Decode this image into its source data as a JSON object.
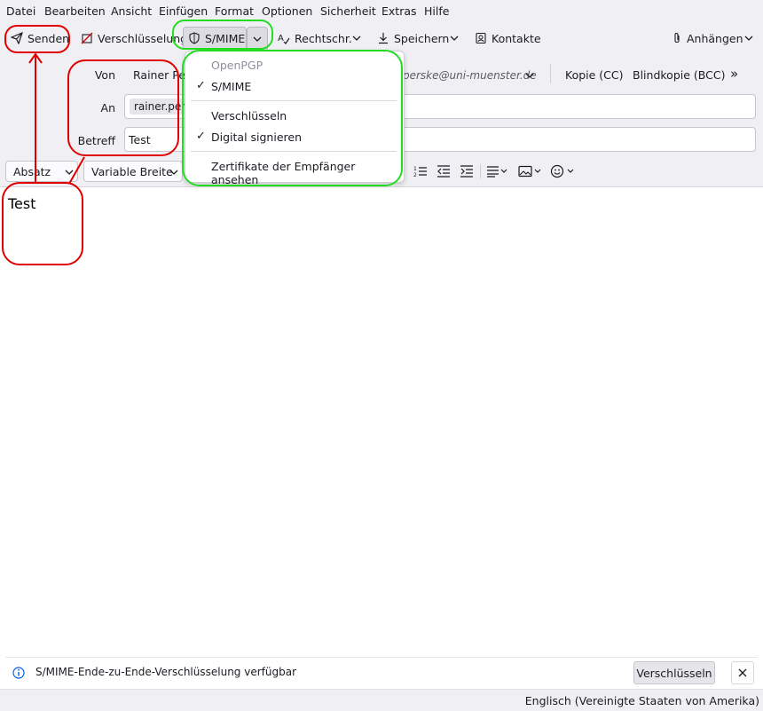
{
  "menubar": {
    "items": [
      {
        "label": "Datei"
      },
      {
        "label": "Bearbeiten"
      },
      {
        "label": "Ansicht"
      },
      {
        "label": "Einfügen"
      },
      {
        "label": "Format"
      },
      {
        "label": "Optionen"
      },
      {
        "label": "Sicherheit"
      },
      {
        "label": "Extras"
      },
      {
        "label": "Hilfe"
      }
    ]
  },
  "toolbar": {
    "send_label": "Senden",
    "encryption_label": "Verschlüsselung",
    "smime_label": "S/MIME",
    "spelling_label": "Rechtschr.",
    "save_label": "Speichern",
    "contacts_label": "Kontakte",
    "attach_label": "Anhängen"
  },
  "header": {
    "from_label": "Von",
    "from_value": "Rainer Pe",
    "from_address_tail": "perske@uni-muenster.de",
    "cc_label": "Kopie (CC)",
    "bcc_label": "Blindkopie (BCC)",
    "to_label": "An",
    "to_recipient": "rainer.per",
    "subject_label": "Betreff",
    "subject_value": "Test"
  },
  "formatbar": {
    "paragraph_label": "Absatz",
    "font_label": "Variable Breite"
  },
  "dropdown": {
    "openpgp_label": "OpenPGP",
    "smime_label": "S/MIME",
    "encrypt_label": "Verschlüsseln",
    "sign_label": "Digital signieren",
    "certs_label": "Zertifikate der Empfänger ansehen"
  },
  "body": {
    "text": "Test"
  },
  "notification": {
    "text": "S/MIME-Ende-zu-Ende-Verschlüsselung verfügbar",
    "button_label": "Verschlüsseln"
  },
  "statusbar": {
    "language": "Englisch (Vereinigte Staaten von Amerika)"
  },
  "colors": {
    "annotation_red": "#e00000",
    "annotation_green": "#22dd22",
    "chrome_bg": "#f0f0f4"
  }
}
